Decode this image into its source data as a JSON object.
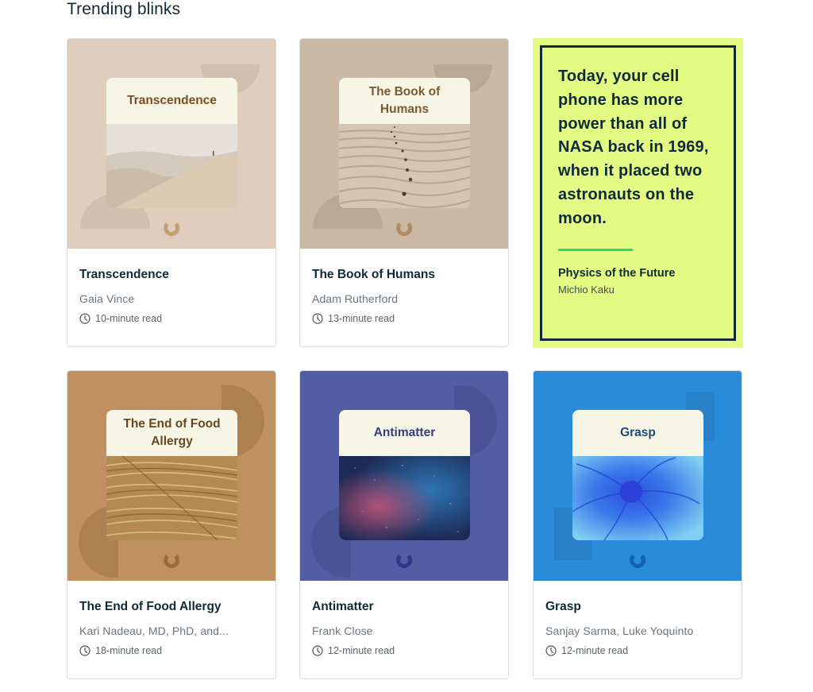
{
  "section": {
    "title": "Trending blinks"
  },
  "cards": [
    {
      "title": "Transcendence",
      "cover_title": "Transcendence",
      "author": "Gaia Vince",
      "duration": "10-minute read",
      "colors": {
        "bg": "#dfcdbd",
        "shape": "#d2bfae",
        "title": "#7a4e24",
        "logo": "#c89f72",
        "image_top": "#e4ddd5",
        "image_bottom": "#cbb89d"
      }
    },
    {
      "title": "The Book of Humans",
      "cover_title": "The Book of Humans",
      "author": "Adam Rutherford",
      "duration": "13-minute read",
      "colors": {
        "bg": "#cab9a5",
        "shape": "#bba892",
        "title": "#7a5a30",
        "logo": "#b38a5d",
        "image_top": "#d6c8b4",
        "image_bottom": "#b9a58c"
      }
    },
    {
      "title": "The End of Food Allergy",
      "cover_title": "The End of Food Allergy",
      "author": "Kari Nadeau, MD, PhD, and...",
      "duration": "18-minute read",
      "colors": {
        "bg": "#c09060",
        "shape": "#ad7f51",
        "title": "#6b4520",
        "logo": "#9a6a3a",
        "image_top": "#a27a44",
        "image_bottom": "#d6b27a"
      }
    },
    {
      "title": "Antimatter",
      "cover_title": "Antimatter",
      "author": "Frank Close",
      "duration": "12-minute read",
      "colors": {
        "bg": "#535da4",
        "shape": "#4a5396",
        "title": "#353f7c",
        "logo": "#2c3a8c",
        "image_top": "#1f2f5c",
        "image_bottom": "#3a6ba8"
      }
    },
    {
      "title": "Grasp",
      "cover_title": "Grasp",
      "author": "Sanjay Sarma, Luke Yoquinto",
      "duration": "12-minute read",
      "colors": {
        "bg": "#2a8bd8",
        "shape": "#2880c9",
        "title": "#1c4b78",
        "logo": "#1463b0",
        "image_top": "#3d7de8",
        "image_bottom": "#6fc6ef"
      }
    }
  ],
  "quote": {
    "text": "Today, your cell phone has more power than all of NASA back in 1969, when it placed two astronauts on the moon.",
    "book": "Physics of the Future",
    "author": "Michio Kaku",
    "colors": {
      "bg": "#e3fb83",
      "border": "#0f2a36",
      "rule": "#2bd96b"
    }
  },
  "icons": {
    "clock": "clock-icon",
    "logo": "blinkist-logo-icon"
  }
}
